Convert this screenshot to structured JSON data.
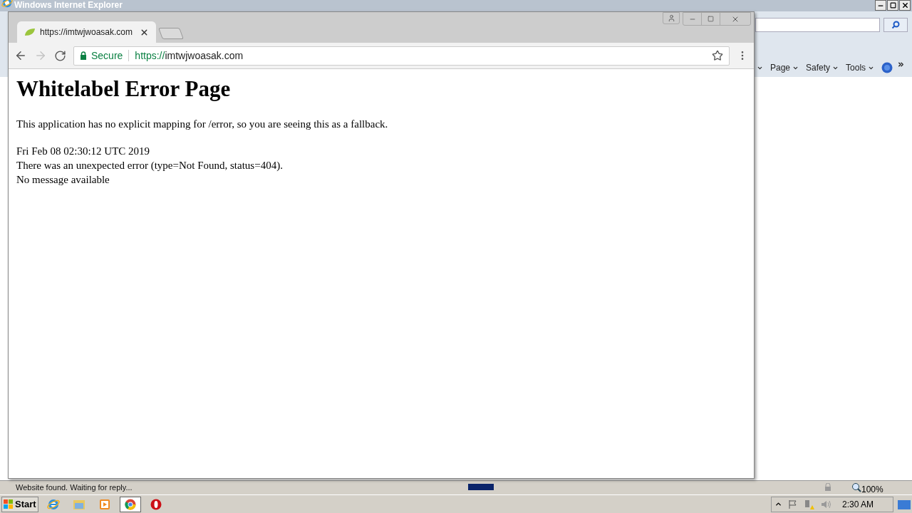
{
  "ie_window": {
    "title": "Windows Internet Explorer",
    "command_bar": [
      {
        "label": "Page"
      },
      {
        "label": "Safety"
      },
      {
        "label": "Tools"
      }
    ],
    "status_text": "Website found. Waiting for reply...",
    "progress": {
      "level": 0.37
    },
    "zoom": "100%"
  },
  "browser": {
    "tabs": [
      {
        "title": "https://imtwjwoasak.com",
        "selected": true
      }
    ],
    "security": "Secure",
    "url_scheme": "https://",
    "url_host": "imtwjwoasak.com"
  },
  "page": {
    "heading": "Whitelabel Error Page",
    "intro": "This application has no explicit mapping for /error, so you are seeing this as a fallback.",
    "lines": [
      "Fri Feb 08 02:30:12 UTC 2019",
      "There was an unexpected error (type=Not Found, status=404).",
      "No message available"
    ]
  },
  "taskbar": {
    "start": "Start",
    "apps": [
      {
        "kind": "ie",
        "selected": false
      },
      {
        "kind": "folder",
        "selected": false
      },
      {
        "kind": "media",
        "selected": false
      },
      {
        "kind": "chrome",
        "selected": true
      },
      {
        "kind": "opera",
        "selected": false
      }
    ],
    "clock": "2:30 AM"
  }
}
